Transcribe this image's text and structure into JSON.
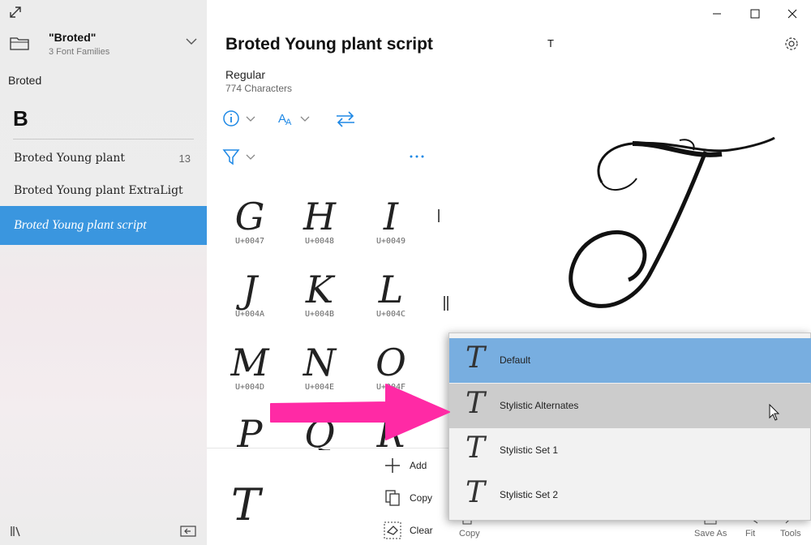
{
  "sidebar": {
    "collection_name": "\"Broted\"",
    "collection_sub": "3 Font Families",
    "family_label": "Broted",
    "group_letter": "B",
    "fonts": [
      {
        "label": "Broted Young plant",
        "count": "13"
      },
      {
        "label": "Broted Young plant ExtraLigt",
        "count": ""
      },
      {
        "label": "Broted Young plant script",
        "count": ""
      }
    ]
  },
  "main": {
    "title": "Broted Young plant script",
    "style": "Regular",
    "char_count": "774 Characters",
    "preview_char": "T"
  },
  "glyphs": [
    {
      "char": "G",
      "code": "U+0047"
    },
    {
      "char": "H",
      "code": "U+0048"
    },
    {
      "char": "I",
      "code": "U+0049"
    },
    {
      "char": "J",
      "code": "U+004A"
    },
    {
      "char": "K",
      "code": "U+004B"
    },
    {
      "char": "L",
      "code": "U+004C"
    },
    {
      "char": "M",
      "code": "U+004D"
    },
    {
      "char": "N",
      "code": "U+004E"
    },
    {
      "char": "O",
      "code": "U+004F"
    },
    {
      "char": "P",
      "code": ""
    },
    {
      "char": "Q",
      "code": ""
    },
    {
      "char": "R",
      "code": ""
    }
  ],
  "compare": {
    "glyph": "T",
    "add_label": "Add",
    "copy_label": "Copy",
    "clear_label": "Clear"
  },
  "flyout": {
    "glyph": "T",
    "variants": [
      {
        "label": "Default",
        "state": "selected"
      },
      {
        "label": "Stylistic Alternates",
        "state": "hover"
      },
      {
        "label": "Stylistic Set 1",
        "state": ""
      },
      {
        "label": "Stylistic Set 2",
        "state": ""
      }
    ]
  },
  "bottom_bar": {
    "copy_label": "Copy",
    "save_as_label": "Save As",
    "fit_label": "Fit",
    "tools_label": "Tools"
  },
  "colors": {
    "selected_blue": "#3a96df",
    "accent_blue": "#1e88e5",
    "flyout_selected": "#78aee0",
    "arrow_pink": "#ff2aa5"
  }
}
